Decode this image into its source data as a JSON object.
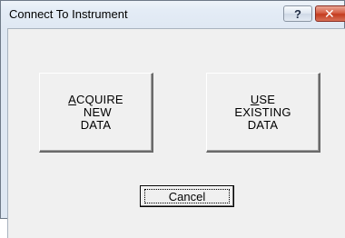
{
  "window": {
    "title": "Connect To Instrument",
    "help_glyph": "?",
    "close_glyph": "✕",
    "help_icon": "question-mark-icon",
    "close_icon": "close-icon"
  },
  "buttons": {
    "acquire_label": "ACQUIRE\n NEW\nDATA",
    "use_existing_label": "USE\nEXISTING\nDATA",
    "cancel_label": "Cancel"
  },
  "colors": {
    "close_red": "#c43c1f",
    "face": "#f0f0f0"
  }
}
